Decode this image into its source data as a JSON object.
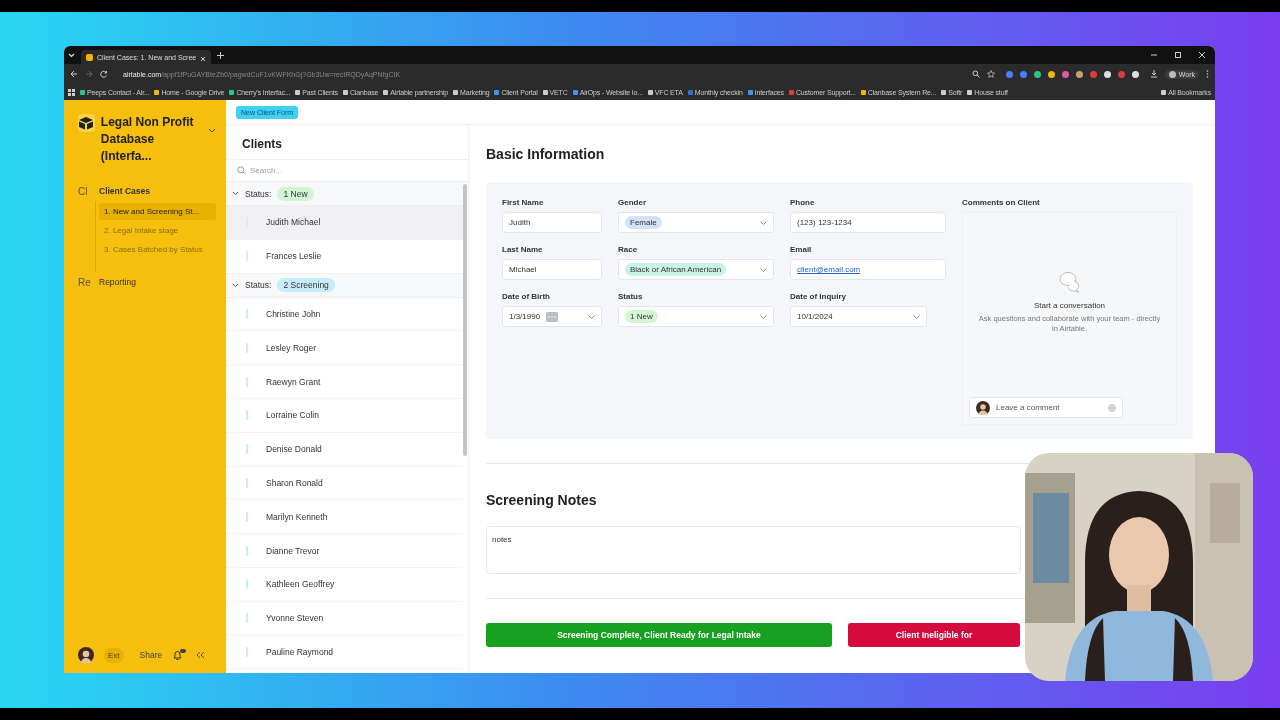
{
  "browser": {
    "tab_title": "Client Cases: 1. New and Scree",
    "url_host": "airtable.com",
    "url_path": "/appf1fPuGAYBteZb0/pagwdCuF1vKWFKhGj?Gb3Uw=recIRQDyAqPNfgCIK",
    "profile": "Work",
    "bookmarks": [
      {
        "label": "Peeps Contact - Air...",
        "color": "#2bc48a"
      },
      {
        "label": "Home - Google Drive",
        "color": "#f4b400"
      },
      {
        "label": "Cherry's Interfac...",
        "color": "#2bc48a"
      },
      {
        "label": "Past Clients",
        "color": "#cccccc"
      },
      {
        "label": "Clanbase",
        "color": "#cccccc"
      },
      {
        "label": "Airtable partnership",
        "color": "#cccccc"
      },
      {
        "label": "Marketing",
        "color": "#cccccc"
      },
      {
        "label": "Client Portal",
        "color": "#4a8cff"
      },
      {
        "label": "VETC",
        "color": "#cccccc"
      },
      {
        "label": "AirOps - Website Io...",
        "color": "#4a8cff"
      },
      {
        "label": "VFC ETA",
        "color": "#cccccc"
      },
      {
        "label": "Monthly checkin",
        "color": "#2f6fd6"
      },
      {
        "label": "Interfaces",
        "color": "#4a8cff"
      },
      {
        "label": "Customer Support...",
        "color": "#e03a3a"
      },
      {
        "label": "Clanbase System Re...",
        "color": "#f4b400"
      },
      {
        "label": "Softr",
        "color": "#cccccc"
      },
      {
        "label": "House stuff",
        "color": "#cccccc"
      }
    ],
    "all_bookmarks": "All Bookmarks"
  },
  "sidebar": {
    "base_name": "Legal Non Profit Database (Interfa...",
    "sections": [
      {
        "abbr": "Cl",
        "label": "Client Cases",
        "children": [
          {
            "label": "1. New and Screening St...",
            "selected": true
          },
          {
            "label": "2. Legal Intake stage",
            "selected": false
          },
          {
            "label": "3. Cases Batched by Status",
            "selected": false
          }
        ]
      },
      {
        "abbr": "Re",
        "label": "Reporting"
      }
    ],
    "footer": {
      "ext": "Ext",
      "share": "Share"
    }
  },
  "top_button": "New Client Form",
  "clients": {
    "title": "Clients",
    "search_placeholder": "Search...",
    "groups": [
      {
        "label": "Status:",
        "tag": "1 New",
        "color": "#d3f5d6",
        "rows": [
          {
            "name": "Judith Michael",
            "selected": true
          },
          {
            "name": "Frances Leslie",
            "selected": false
          }
        ]
      },
      {
        "label": "Status:",
        "tag": "2 Screening",
        "color": "#c7ecfb",
        "rows": [
          {
            "name": "Christine John",
            "selected": false
          },
          {
            "name": "Lesley Roger",
            "selected": false
          },
          {
            "name": "Raewyn Grant",
            "selected": false
          },
          {
            "name": "Lorraine Colin",
            "selected": false
          },
          {
            "name": "Denise Donald",
            "selected": false
          },
          {
            "name": "Sharon Ronald",
            "selected": false
          },
          {
            "name": "Marilyn Kenneth",
            "selected": false
          },
          {
            "name": "Dianne Trevor",
            "selected": false
          },
          {
            "name": "Kathleen Geoffrey",
            "selected": false
          },
          {
            "name": "Yvonne Steven",
            "selected": false
          },
          {
            "name": "Pauline Raymond",
            "selected": false
          }
        ]
      }
    ]
  },
  "basic_information": {
    "title": "Basic Information",
    "fields": [
      {
        "label": "First Name",
        "kind": "text",
        "value": "Judith"
      },
      {
        "label": "Gender",
        "kind": "select",
        "value": "Female",
        "color": "#d3e2fa"
      },
      {
        "label": "Phone",
        "kind": "text",
        "value": "(123) 123-1234"
      },
      {
        "label": "Last Name",
        "kind": "text",
        "value": "Michael"
      },
      {
        "label": "Race",
        "kind": "select",
        "value": "Black or African American",
        "color": "#c8f4e4"
      },
      {
        "label": "Email",
        "kind": "email",
        "value": "client@email.com"
      },
      {
        "label": "Date of Birth",
        "kind": "dob",
        "value": "1/3/1990"
      },
      {
        "label": "Status",
        "kind": "select",
        "value": "1 New",
        "color": "#d3f5d6"
      },
      {
        "label": "Date of Inquiry",
        "kind": "date",
        "value": "10/1/2024"
      }
    ],
    "comments": {
      "title": "Comments on Client",
      "heading": "Start a conversation",
      "description": "Ask questions and collaborate with your team - directly in Airtable.",
      "placeholder": "Leave a comment"
    }
  },
  "screening_notes": {
    "title": "Screening Notes",
    "value": "notes"
  },
  "actions": [
    {
      "label": "Screening Complete, Client Ready for Legal Intake",
      "kind": "confirm"
    },
    {
      "label": "Client Ineligible for",
      "kind": "reject"
    }
  ]
}
